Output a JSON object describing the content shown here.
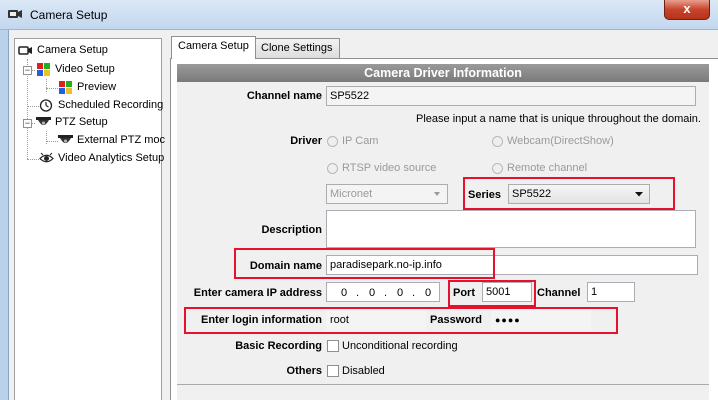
{
  "window": {
    "title": "Camera Setup",
    "close_label": "x"
  },
  "tree": {
    "items": [
      {
        "label": "Camera Setup"
      },
      {
        "label": "Video Setup"
      },
      {
        "label": "Preview"
      },
      {
        "label": "Scheduled Recording"
      },
      {
        "label": "PTZ Setup"
      },
      {
        "label": "External PTZ moc"
      },
      {
        "label": "Video Analytics Setup"
      }
    ]
  },
  "tabs": [
    {
      "label": "Camera Setup",
      "active": true
    },
    {
      "label": "Clone Settings",
      "active": false
    }
  ],
  "section_title": "Camera Driver Information",
  "form": {
    "channel_name_label": "Channel name",
    "channel_name_value": "SP5522",
    "unique_hint": "Please input a name that is unique throughout the domain.",
    "driver_label": "Driver",
    "driver_options": [
      "IP Cam",
      "Webcam(DirectShow)",
      "RTSP video source",
      "Remote channel"
    ],
    "driver_selected": "IP Cam",
    "brand_value": "Micronet",
    "series_label": "Series",
    "series_value": "SP5522",
    "description_label": "Description",
    "description_value": "",
    "domain_name_label": "Domain name",
    "domain_name_value": "paradisepark.no-ip.info",
    "ip_label": "Enter camera IP address",
    "ip_octets": [
      "0",
      "0",
      "0",
      "0"
    ],
    "ip_sep": ".",
    "port_label": "Port",
    "port_value": "5001",
    "channel_label": "Channel",
    "channel_value": "1",
    "login_label": "Enter login information",
    "login_value": "root",
    "password_label": "Password",
    "password_value": "●●●●",
    "basic_recording_label": "Basic Recording",
    "unconditional_label": "Unconditional recording",
    "others_label": "Others",
    "disabled_label": "Disabled"
  },
  "colors": {
    "highlight": "#e8112d",
    "header_bg": "#8a8a8a"
  }
}
